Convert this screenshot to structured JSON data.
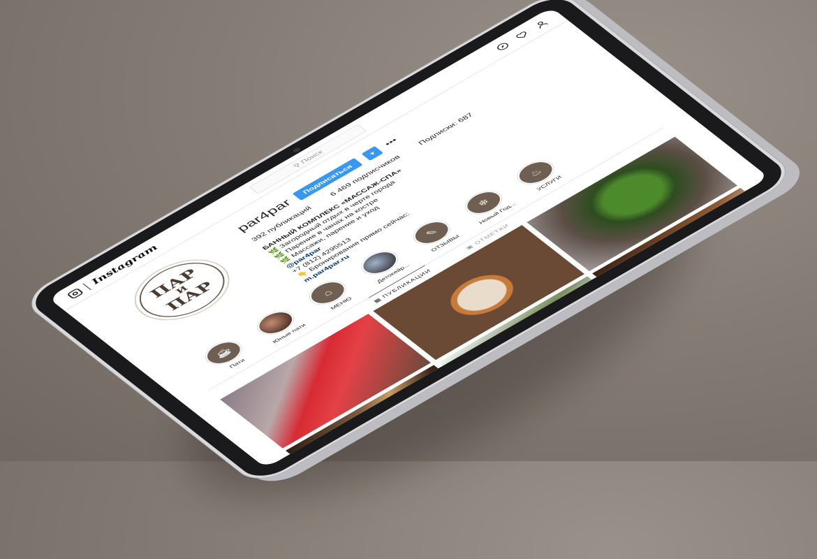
{
  "topbar": {
    "brand": "Instagram",
    "search_placeholder": "Поиск"
  },
  "profile": {
    "username": "par4par",
    "subscribe_label": "Подписаться",
    "more_label": "▾",
    "dots": "•••",
    "stats": {
      "posts": "392 публикаций",
      "followers": "6 469 подписчиков",
      "following": "Подписки: 687"
    },
    "bio": {
      "title": "БАННЫЙ КОМПЛЕКС «МАССАЖ-СПА»",
      "line1": "Загородный отдых в черте города",
      "line2": "Парение в чанах на костре",
      "line3": "Массажи, парение и уход",
      "handle": "@par4par",
      "phone": "+7 (812) 4295513",
      "line4": "Бронирование прямо сейчас:",
      "link": "m.par4par.ru"
    },
    "avatar_text": [
      "ПАР",
      "И",
      "ПАР"
    ]
  },
  "highlights": [
    {
      "label": "Пати",
      "style": "icon",
      "glyph": "☕"
    },
    {
      "label": "Юные пати",
      "style": "photo1",
      "glyph": ""
    },
    {
      "label": "МЕНЮ",
      "style": "icon",
      "glyph": "⌂"
    },
    {
      "label": "Детокейр...",
      "style": "photo2",
      "glyph": ""
    },
    {
      "label": "ОТЗЫВЫ",
      "style": "icon",
      "glyph": "✎"
    },
    {
      "label": "Новый Год...",
      "style": "icon",
      "glyph": "❄"
    },
    {
      "label": "УСЛУГИ",
      "style": "icon",
      "glyph": "♨"
    }
  ],
  "tabs": {
    "posts": "ПУБЛИКАЦИИ",
    "tagged": "ОТМЕТКИ"
  }
}
